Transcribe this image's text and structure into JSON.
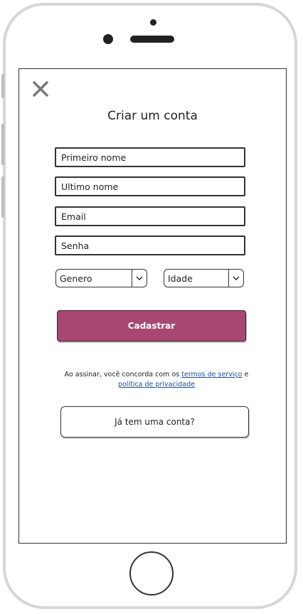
{
  "signup": {
    "title": "Criar um conta",
    "fields": {
      "first_name": {
        "placeholder": "Primeiro nome",
        "value": ""
      },
      "last_name": {
        "placeholder": "Ultimo nome",
        "value": ""
      },
      "email": {
        "placeholder": "Email",
        "value": ""
      },
      "password": {
        "placeholder": "Senha",
        "value": ""
      }
    },
    "gender_select": {
      "selected": "Genero"
    },
    "age_select": {
      "selected": "Idade"
    },
    "submit_label": "Cadastrar",
    "terms": {
      "prefix": "Ao assinar, você concorda com os ",
      "terms_link": "termos de serviço",
      "connector": " e ",
      "privacy_link": "política de privacidade"
    },
    "login_label": "Já tem uma conta?"
  },
  "colors": {
    "primary": "#a84872",
    "link": "#1a4f8f",
    "frame": "#d6d6d6"
  },
  "icons": {
    "close": "close-icon",
    "dropdown": "chevron-down-icon"
  }
}
